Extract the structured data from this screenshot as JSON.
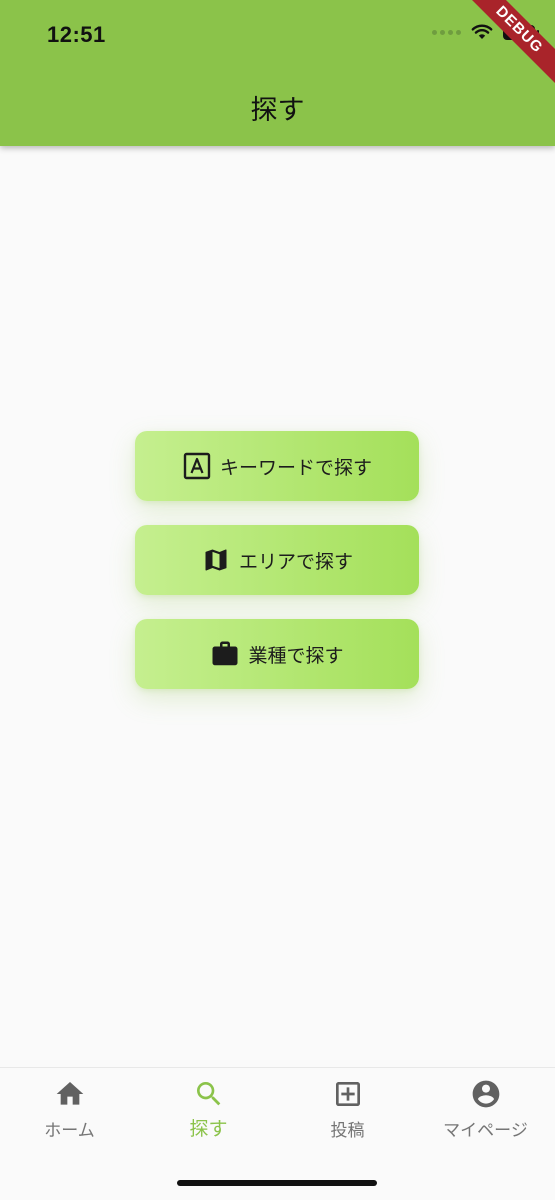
{
  "status_bar": {
    "time": "12:51"
  },
  "debug_banner": "DEBUG",
  "header": {
    "title": "探す"
  },
  "search_options": [
    {
      "label": "キーワードで探す",
      "icon": "keyword-a-icon"
    },
    {
      "label": "エリアで探す",
      "icon": "map-icon"
    },
    {
      "label": "業種で探す",
      "icon": "briefcase-icon"
    }
  ],
  "bottom_nav": {
    "items": [
      {
        "label": "ホーム",
        "icon": "home-icon",
        "active": false
      },
      {
        "label": "探す",
        "icon": "search-icon",
        "active": true
      },
      {
        "label": "投稿",
        "icon": "add-box-icon",
        "active": false
      },
      {
        "label": "マイページ",
        "icon": "account-circle-icon",
        "active": false
      }
    ]
  },
  "colors": {
    "primary": "#8bc34a",
    "button_gradient_start": "#c5ef8f",
    "button_gradient_end": "#a4e05a",
    "inactive": "#757575",
    "debug_ribbon": "#a9242a"
  }
}
